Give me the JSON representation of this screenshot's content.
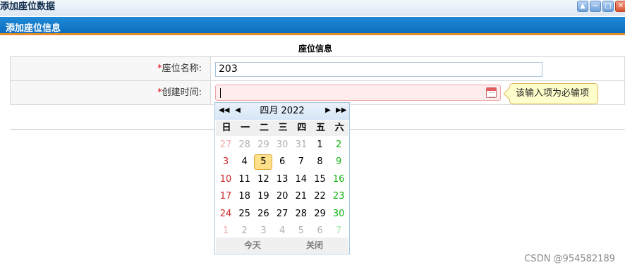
{
  "window": {
    "title": "添加座位数据",
    "controls": [
      "collapse",
      "minimize",
      "maximize",
      "close"
    ]
  },
  "section": {
    "title": "添加座位信息"
  },
  "form": {
    "caption": "座位信息",
    "required_mark": "*",
    "fields": [
      {
        "label": "座位名称:",
        "value": "203"
      },
      {
        "label": "创建时间:",
        "value": ""
      }
    ],
    "validation_tip": "该输入项为必输项"
  },
  "calendar": {
    "month_label": "四月 2022",
    "nav": {
      "prev_year": "◀◀",
      "prev_month": "◀",
      "next_month": "▶",
      "next_year": "▶▶"
    },
    "weekdays": [
      "日",
      "一",
      "二",
      "三",
      "四",
      "五",
      "六"
    ],
    "weeks": [
      [
        "27",
        "28",
        "29",
        "30",
        "31",
        "1",
        "2"
      ],
      [
        "3",
        "4",
        "5",
        "6",
        "7",
        "8",
        "9"
      ],
      [
        "10",
        "11",
        "12",
        "13",
        "14",
        "15",
        "16"
      ],
      [
        "17",
        "18",
        "19",
        "20",
        "21",
        "22",
        "23"
      ],
      [
        "24",
        "25",
        "26",
        "27",
        "28",
        "29",
        "30"
      ],
      [
        "1",
        "2",
        "3",
        "4",
        "5",
        "6",
        "7"
      ]
    ],
    "other_month_rows": {
      "first": [
        0,
        1,
        2,
        3,
        4
      ],
      "last": [
        0,
        1,
        2,
        3,
        4,
        5,
        6
      ]
    },
    "selected_day": "5",
    "today_label": "今天",
    "close_label": "关闭",
    "colors": {
      "sunday": "#d02828",
      "saturday": "#12b212",
      "highlight": "#ffe08a"
    }
  },
  "watermark": "CSDN @954582189"
}
